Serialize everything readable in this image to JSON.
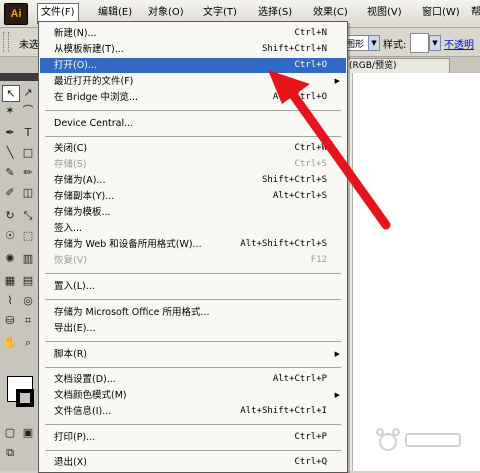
{
  "app": {
    "logo_text": "Ai"
  },
  "menubar": {
    "items": [
      "文件(F)",
      "编辑(E)",
      "对象(O)",
      "文字(T)",
      "选择(S)",
      "效果(C)",
      "视图(V)",
      "窗口(W)",
      "帮"
    ]
  },
  "controlbar": {
    "left_text": "未选",
    "graphic_style_text": "图形",
    "style_label": "样式:",
    "opacity_link": "不透明"
  },
  "document": {
    "tab_label": "(RGB/预览)",
    "close": "×"
  },
  "file_menu": {
    "items": [
      {
        "label": "新建(N)...",
        "shortcut": "Ctrl+N"
      },
      {
        "label": "从模板新建(T)...",
        "shortcut": "Shift+Ctrl+N"
      },
      {
        "label": "打开(O)...",
        "shortcut": "Ctrl+O",
        "highlighted": true
      },
      {
        "label": "最近打开的文件(F)",
        "submenu": true
      },
      {
        "label": "在 Bridge 中浏览...",
        "shortcut": "Alt+Ctrl+O"
      },
      {
        "label": "Device Central..."
      },
      {
        "label": "关闭(C)",
        "shortcut": "Ctrl+W"
      },
      {
        "label": "存储(S)",
        "shortcut": "Ctrl+S",
        "disabled": true
      },
      {
        "label": "存储为(A)...",
        "shortcut": "Shift+Ctrl+S"
      },
      {
        "label": "存储副本(Y)...",
        "shortcut": "Alt+Ctrl+S"
      },
      {
        "label": "存储为模板..."
      },
      {
        "label": "签入..."
      },
      {
        "label": "存储为 Web 和设备所用格式(W)...",
        "shortcut": "Alt+Shift+Ctrl+S"
      },
      {
        "label": "恢复(V)",
        "shortcut": "F12",
        "disabled": true
      },
      {
        "label": "置入(L)..."
      },
      {
        "label": "存储为 Microsoft Office 所用格式..."
      },
      {
        "label": "导出(E)..."
      },
      {
        "label": "脚本(R)",
        "submenu": true
      },
      {
        "label": "文档设置(D)...",
        "shortcut": "Alt+Ctrl+P"
      },
      {
        "label": "文档颜色模式(M)",
        "submenu": true
      },
      {
        "label": "文件信息(I)...",
        "shortcut": "Alt+Shift+Ctrl+I"
      },
      {
        "label": "打印(P)...",
        "shortcut": "Ctrl+P"
      },
      {
        "label": "退出(X)",
        "shortcut": "Ctrl+Q"
      }
    ]
  },
  "colors": {
    "highlight": "#316ac5",
    "arrow": "#e8141c",
    "disabled": "#9c9a94"
  }
}
